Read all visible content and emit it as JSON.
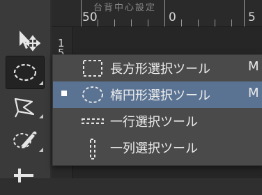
{
  "ruler": {
    "numbers": [
      "50",
      "0",
      "5"
    ],
    "top_faint_label": "台背中心設定"
  },
  "left_ruler": {
    "numbers": [
      "1",
      "5"
    ]
  },
  "tools": [
    {
      "name": "move-tool",
      "icon": "move-arrow-icon"
    },
    {
      "name": "marquee-tool",
      "icon": "elliptical-marquee-icon",
      "active": true
    },
    {
      "name": "lasso-tool",
      "icon": "polygonal-lasso-icon"
    },
    {
      "name": "quick-selection-tool",
      "icon": "quick-selection-brush-icon"
    },
    {
      "name": "crop-tool",
      "icon": "crop-icon"
    }
  ],
  "flyout": {
    "items": [
      {
        "label": "長方形選択ツール",
        "shortcut": "M",
        "icon": "rectangular-marquee-icon",
        "selected": false
      },
      {
        "label": "楕円形選択ツール",
        "shortcut": "M",
        "icon": "elliptical-marquee-icon",
        "selected": true
      },
      {
        "label": "一行選択ツール",
        "shortcut": "",
        "icon": "single-row-marquee-icon",
        "selected": false
      },
      {
        "label": "一列選択ツール",
        "shortcut": "",
        "icon": "single-column-marquee-icon",
        "selected": false
      }
    ]
  },
  "colors": {
    "selection_highlight": "#5b7392",
    "menu_bg": "#4a4a4a",
    "panel_bg": "#3a3a3a"
  }
}
